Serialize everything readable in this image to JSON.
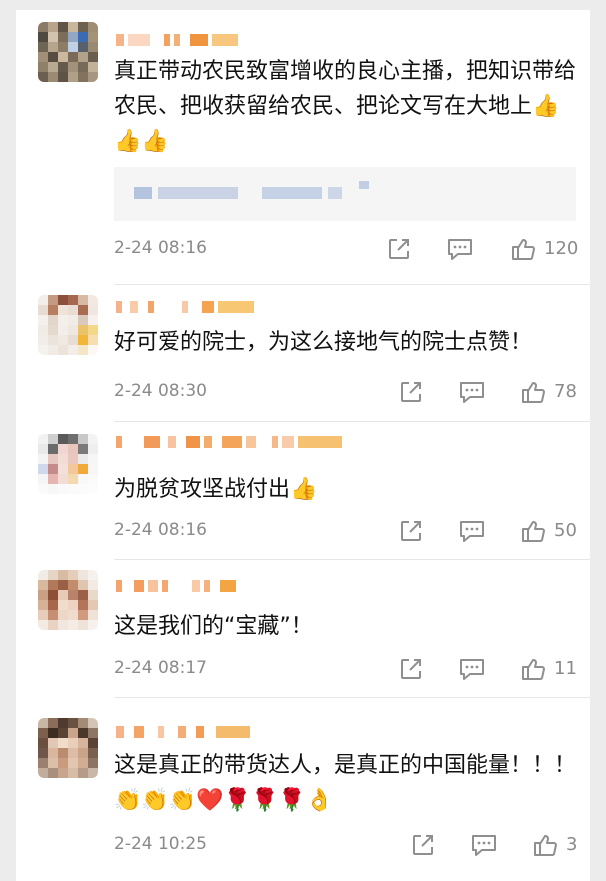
{
  "comments": [
    {
      "username": "",
      "text": "真正带动农民致富增收的良心主播，把知识带给农民、把收获留给农民、把论文写在大地上👍👍👍",
      "quote": "",
      "time": "2-24 08:16",
      "likes": "120",
      "avatar_colors": [
        "#8a7a66",
        "#b9a38a",
        "#5f5446",
        "#c8b79a",
        "#6d6152",
        "#9f8d74",
        "#4f4a3f",
        "#d2c3ad",
        "#7c6e5a",
        "#93a7c4",
        "#3b6bb0",
        "#a69277",
        "#6e6554",
        "#b5a58c",
        "#8d7d66",
        "#c0d0e6",
        "#58606d",
        "#9a8a72",
        "#a18f77",
        "#584c40",
        "#cbb99f",
        "#7a6a57",
        "#b3a28a",
        "#6a5e4f",
        "#8f806a",
        "#b8a991",
        "#655a4c",
        "#a3927b",
        "#776a58",
        "#c2b29a",
        "#6b5f50",
        "#9c8b73",
        "#5e5446",
        "#b0a088",
        "#82735e",
        "#a89780"
      ]
    },
    {
      "username": "",
      "text": "好可爱的院士，为这么接地气的院士点赞！",
      "time": "2-24 08:30",
      "likes": "78",
      "avatar_colors": [
        "#f3eee9",
        "#c49a80",
        "#8b4f3b",
        "#a5684f",
        "#d7b9a5",
        "#f1e9e2",
        "#e8dcd2",
        "#b97d61",
        "#f0e4da",
        "#e9ddd3",
        "#a86c52",
        "#efe7e0",
        "#f4f0ec",
        "#e2d5ca",
        "#f5efe9",
        "#f2ece6",
        "#d9c9bc",
        "#f6f1ec",
        "#f0ebe5",
        "#e5d8cd",
        "#f3eee9",
        "#efe8e1",
        "#e9c46a",
        "#f4d88a",
        "#f2ede8",
        "#ebe3dc",
        "#f0e9e2",
        "#e7ddd4",
        "#f2b63a",
        "#f7ddb0",
        "#f5f1ed",
        "#f1ebe5",
        "#ece3db",
        "#f3ede7",
        "#f5e6c9",
        "#fbf7f2"
      ]
    },
    {
      "username": "",
      "text": "为脱贫攻坚战付出👍",
      "time": "2-24 08:16",
      "likes": "50",
      "avatar_colors": [
        "#f2f2f2",
        "#cfcfcf",
        "#5a5a5a",
        "#6e6e6e",
        "#c8c8c8",
        "#f3f3f3",
        "#e9e9e9",
        "#6b6b6b",
        "#f0d6d0",
        "#e8c6be",
        "#7a7a7a",
        "#eeeeee",
        "#f4f4f4",
        "#e6c8c0",
        "#f1dcd6",
        "#e9c7bd",
        "#eaeaea",
        "#f6f6f6",
        "#cfd8ec",
        "#c58a8a",
        "#f3e0db",
        "#f2c79a",
        "#f2a93b",
        "#f6f6f6",
        "#f5f5f5",
        "#e6b5b0",
        "#f4dcd6",
        "#f3d9b0",
        "#f8f8f8",
        "#fafafa",
        "#fafafa",
        "#f7f7f7",
        "#f9f9f9",
        "#fafafa",
        "#fbfbfb",
        "#fcfcfc"
      ]
    },
    {
      "username": "",
      "text": "这是我们的“宝藏”！",
      "time": "2-24 08:17",
      "likes": "11",
      "avatar_colors": [
        "#f1ece6",
        "#e6d5c5",
        "#d8bba3",
        "#e4cdb9",
        "#efe5dc",
        "#f5f1ec",
        "#d9b8a0",
        "#b07a5a",
        "#9a5f44",
        "#c38d6c",
        "#e0c6b0",
        "#f2ebe4",
        "#caa084",
        "#8e4f37",
        "#e7cbb6",
        "#b9826a",
        "#9b6047",
        "#e9d9cb",
        "#d6b197",
        "#a8674c",
        "#f1dccc",
        "#efd3c2",
        "#b37559",
        "#e4c8b2",
        "#e7cdb9",
        "#c68e72",
        "#ecd6c6",
        "#f0dccd",
        "#cf9a7f",
        "#efe2d7",
        "#f3ebe3",
        "#e9d2c1",
        "#f2e7de",
        "#f4ece5",
        "#efe3d9",
        "#f6f1ec"
      ]
    },
    {
      "username": "",
      "text": "这是真正的带货达人，是真正的中国能量！！！👏👏👏❤️🌹🌹🌹👌",
      "time": "2-24 10:25",
      "likes": "3",
      "avatar_colors": [
        "#c9b7a6",
        "#8a6d5a",
        "#4e3a2e",
        "#6b5142",
        "#a48b78",
        "#d3c4b6",
        "#7c5f4d",
        "#3d2c22",
        "#5a4234",
        "#caa58c",
        "#4c372b",
        "#8f7563",
        "#6a4f40",
        "#e2c8b4",
        "#f0dcc9",
        "#e9cfba",
        "#d6b59c",
        "#5b4436",
        "#70564a",
        "#d9b69d",
        "#b98c70",
        "#dcbca4",
        "#caa489",
        "#7a604f",
        "#9b8070",
        "#dbbfa8",
        "#c99c7f",
        "#e2c6b0",
        "#d1ae93",
        "#8e7462",
        "#c2ad9c",
        "#a98f7d",
        "#c7a58c",
        "#d8bda6",
        "#b69b88",
        "#cbb7a7"
      ]
    }
  ],
  "icons": {
    "repost": "repost-icon",
    "comment": "comment-icon",
    "like": "thumbs-up-icon"
  }
}
